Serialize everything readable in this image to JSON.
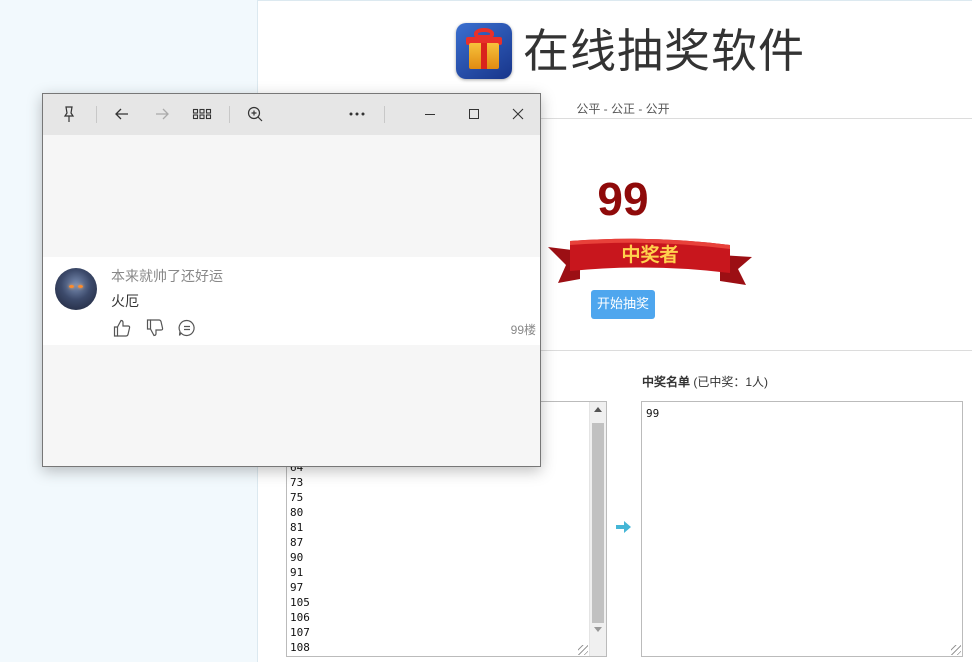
{
  "page": {
    "title": "在线抽奖软件",
    "subtitle": "公平 - 公正 - 公开",
    "winner_number": "99",
    "banner_text": "中奖者",
    "start_button": "开始抽奖",
    "winners_label_bold": "中奖名单",
    "winners_label_count": "(已中奖：1人)",
    "participants_visible": [
      "64",
      "73",
      "75",
      "80",
      "81",
      "87",
      "90",
      "91",
      "97",
      "105",
      "106",
      "107",
      "108"
    ],
    "winners_value": "99"
  },
  "viewer": {
    "toolbar_icons": [
      "pin-icon",
      "back-arrow-icon",
      "forward-arrow-icon",
      "grid-icon",
      "zoom-in-icon",
      "more-icon",
      "minimize-icon",
      "maximize-icon",
      "close-icon"
    ],
    "comment": {
      "username": "本来就帅了还好运",
      "text": "火厄",
      "floor": "99楼"
    }
  },
  "colors": {
    "winner_number": "#8f0a0a",
    "start_button": "#4ea6ee",
    "banner_red": "#c8161d",
    "banner_gold": "#ffd24d",
    "arrow": "#45b6d6"
  }
}
